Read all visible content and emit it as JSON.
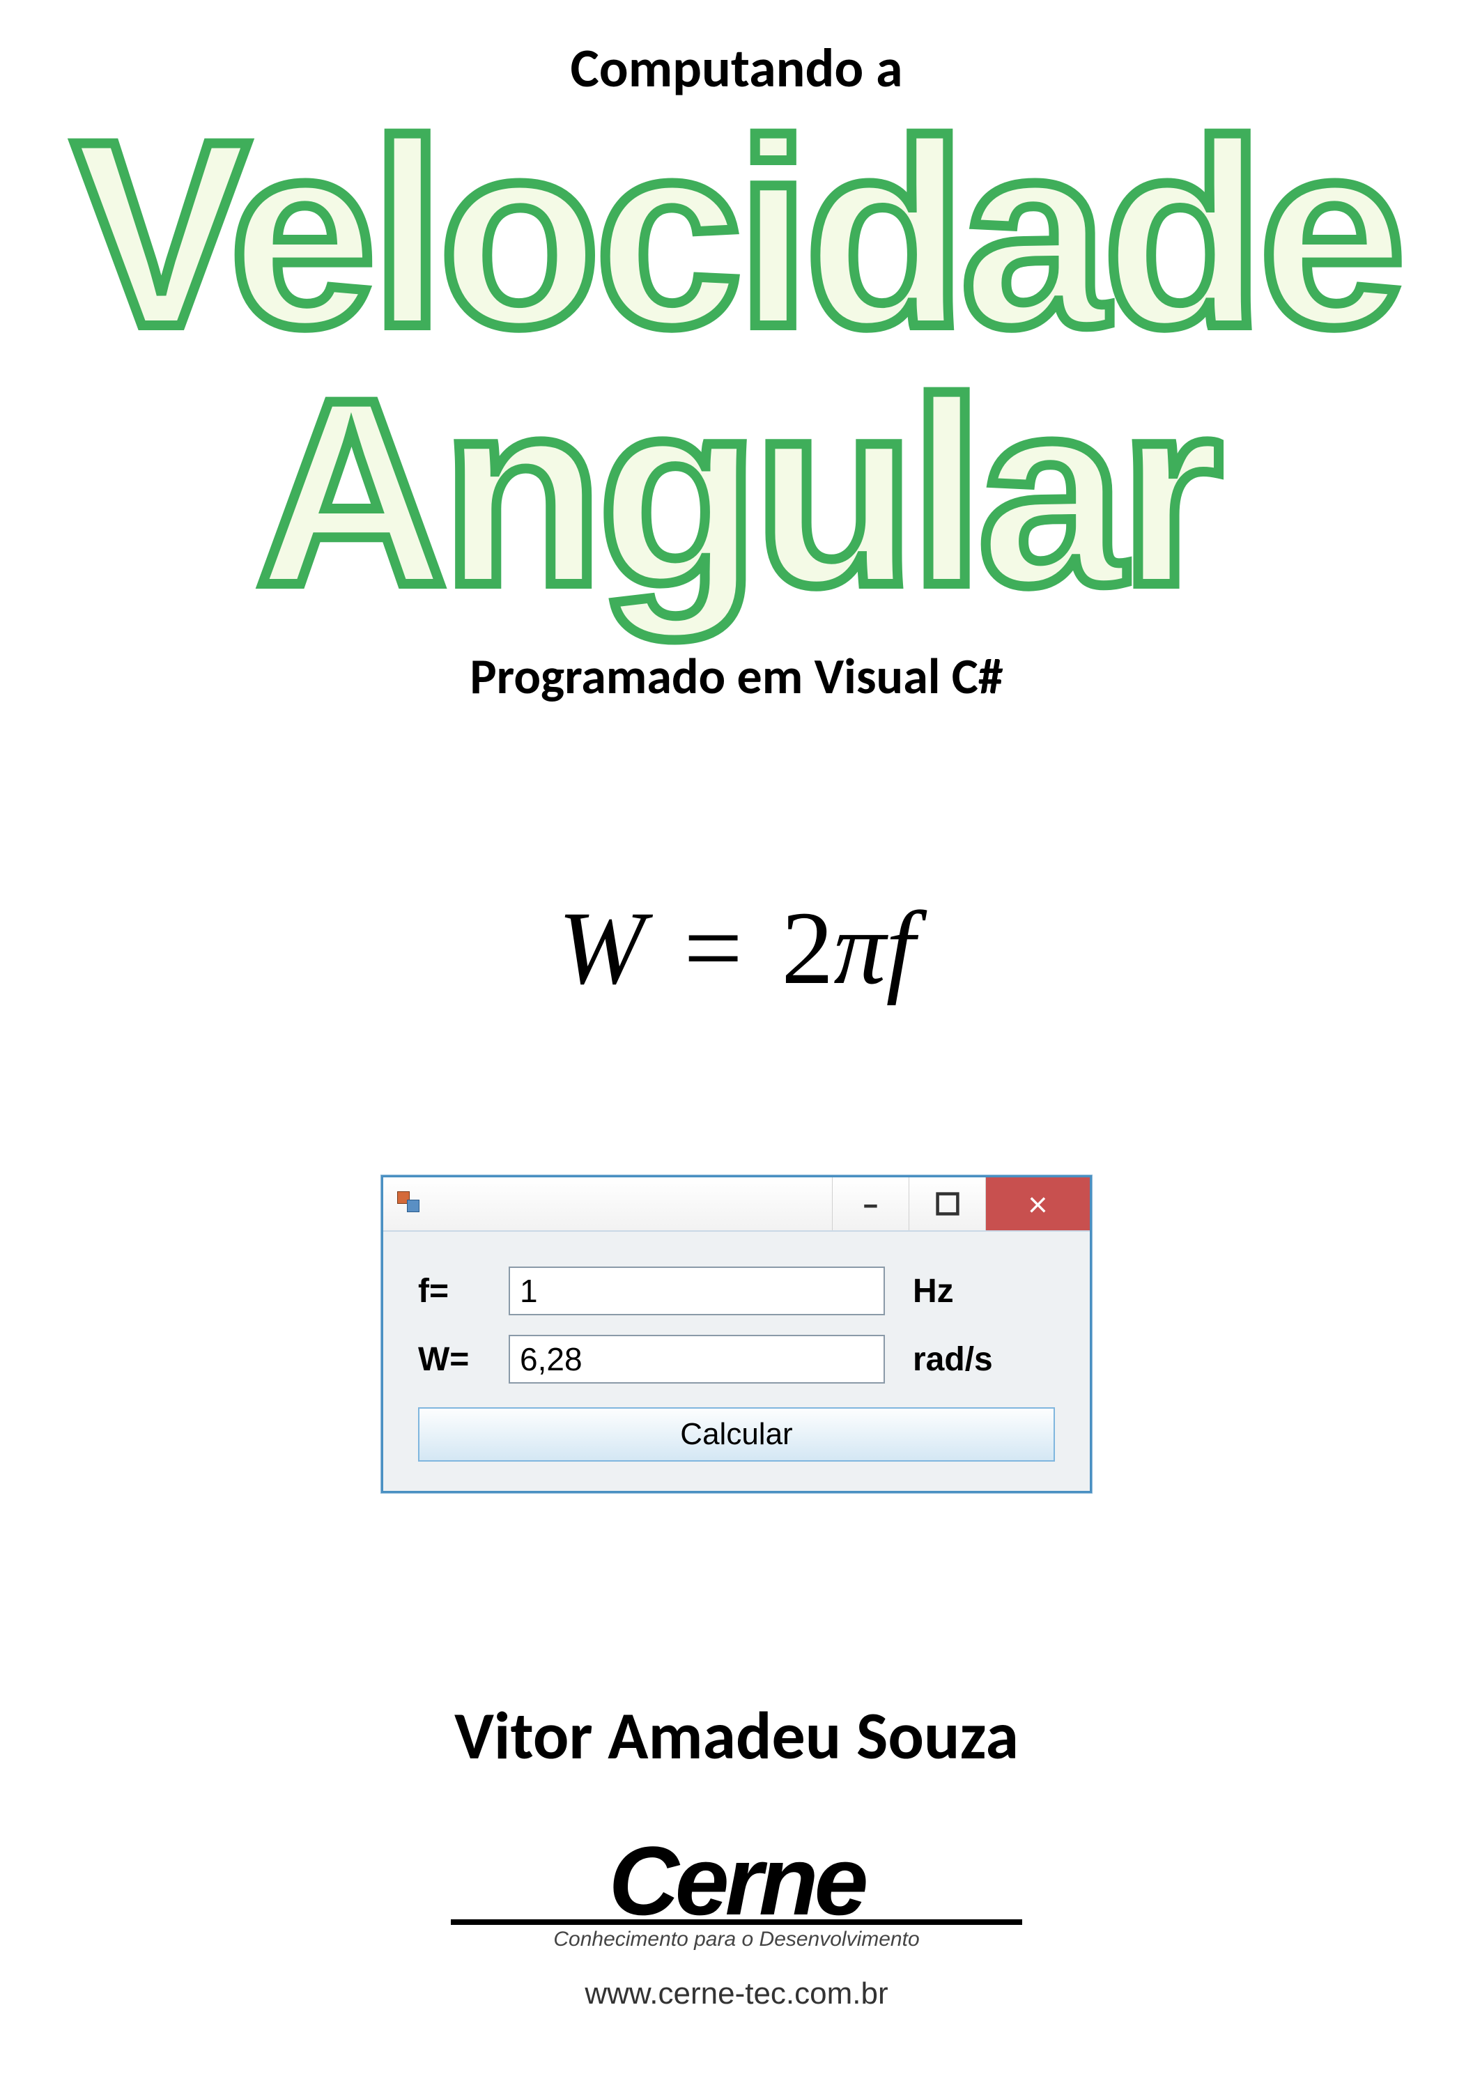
{
  "header": {
    "topline": "Computando a",
    "title_line1": "Velocidade",
    "title_line2": "Angular",
    "subtitle": "Programado em Visual C#"
  },
  "formula": {
    "lhs": "W",
    "eq": "=",
    "rhs_coef": "2",
    "rhs_pi": "π",
    "rhs_var": "f"
  },
  "form": {
    "rows": [
      {
        "label": "f=",
        "value": "1",
        "unit": "Hz"
      },
      {
        "label": "W=",
        "value": "6,28",
        "unit": "rad/s"
      }
    ],
    "button": "Calcular"
  },
  "author": "Vitor Amadeu Souza",
  "brand": {
    "name": "Cerne",
    "tagline": "Conhecimento para o Desenvolvimento",
    "website": "www.cerne-tec.com.br"
  }
}
